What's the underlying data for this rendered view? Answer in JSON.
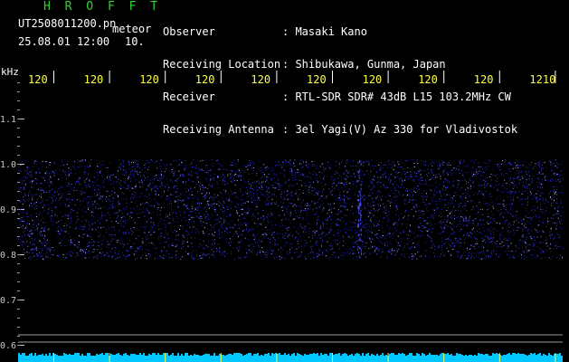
{
  "header": {
    "brand": "H R O F F T",
    "filename": "UT2508011200.pn",
    "type_label": "meteor",
    "datetime": "25.08.01 12:00",
    "number": "10.",
    "info": [
      {
        "label": "Observer",
        "value": ": Masaki Kano"
      },
      {
        "label": "Receiving Location",
        "value": ": Shibukawa, Gunma, Japan"
      },
      {
        "label": "Receiver",
        "value": ": RTL-SDR SDR# 43dB L15 103.2MHz CW"
      },
      {
        "label": "Receiving Antenna",
        "value": ": 3el Yagi(V) Az 330 for Vladivostok"
      }
    ]
  },
  "colors": {
    "brand": "#2bd62b",
    "text": "#ffffff",
    "axis_labels": "#ffff40",
    "tick_marks": "#ffffff",
    "noise": "#3434ff",
    "baseline": "#00c8ff",
    "reference_lines": "#9a9a9a"
  },
  "chart_data": {
    "type": "heatmap",
    "ylabel": "kHz",
    "x_tick_labels": [
      "120",
      "120",
      "120",
      "120",
      "120",
      "120",
      "120",
      "120",
      "120",
      "1210"
    ],
    "y_ticks": [
      {
        "value": 1.1,
        "label": "1.1"
      },
      {
        "value": 1.0,
        "label": "1.0"
      },
      {
        "value": 0.9,
        "label": "0.9"
      },
      {
        "value": 0.8,
        "label": "0.8"
      },
      {
        "value": 0.7,
        "label": "0.7"
      },
      {
        "value": 0.6,
        "label": "0.6"
      }
    ],
    "ylim": [
      0.58,
      1.21
    ],
    "signal_band_khz": [
      0.79,
      1.01
    ],
    "grid": false,
    "reference_lines_khz": [
      0.623,
      0.607
    ]
  }
}
